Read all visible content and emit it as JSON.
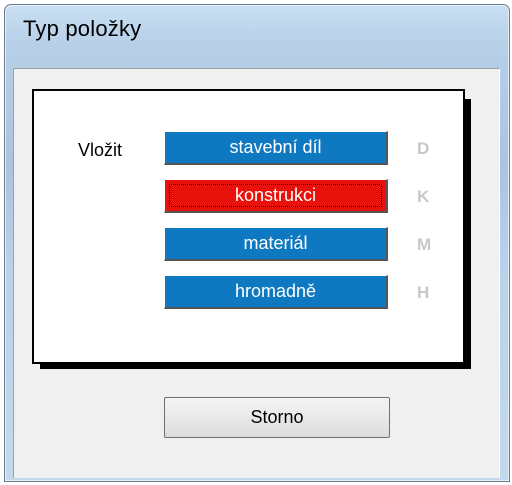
{
  "window": {
    "title": "Typ položky"
  },
  "dialog": {
    "insert_label": "Vložit",
    "options": [
      {
        "label": "stavební díl",
        "shortcut": "D",
        "selected": false
      },
      {
        "label": "konstrukci",
        "shortcut": "K",
        "selected": true
      },
      {
        "label": "materiál",
        "shortcut": "M",
        "selected": false
      },
      {
        "label": "hromadně",
        "shortcut": "H",
        "selected": false
      }
    ],
    "cancel_label": "Storno"
  },
  "colors": {
    "option_default": "#0e79c1",
    "option_selected": "#e8110b",
    "shortcut_text": "#c8c8c8"
  }
}
